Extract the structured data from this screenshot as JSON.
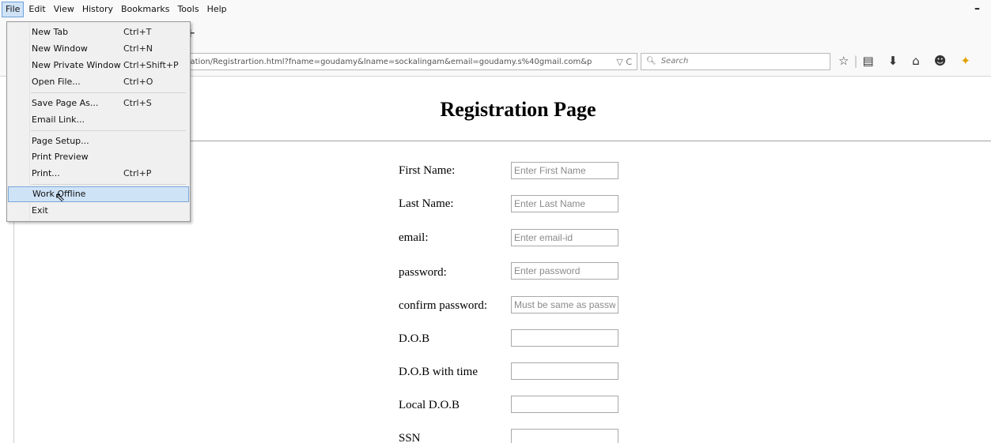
{
  "menubar": {
    "items": [
      {
        "label": "File",
        "active": true
      },
      {
        "label": "Edit"
      },
      {
        "label": "View"
      },
      {
        "label": "History"
      },
      {
        "label": "Bookmarks"
      },
      {
        "label": "Tools"
      },
      {
        "label": "Help"
      }
    ],
    "minimize": "–"
  },
  "tabs": {
    "newtab": "+"
  },
  "navbar": {
    "url": "cation/Registrartion.html?fname=goudamy&lname=sockalingam&email=goudamy.s%40gmail.com&p",
    "url_icons": "▽ C",
    "search_placeholder": "Search",
    "icons": [
      "star-icon",
      "reading-list-icon",
      "download-icon",
      "home-icon",
      "chat-icon",
      "extension-icon"
    ]
  },
  "page": {
    "title": "Registration Page",
    "fields": [
      {
        "label": "First Name:",
        "placeholder": "Enter First Name",
        "value": ""
      },
      {
        "label": "Last Name:",
        "placeholder": "Enter Last Name",
        "value": ""
      },
      {
        "label": "email:",
        "placeholder": "Enter email-id",
        "value": ""
      },
      {
        "label": "password:",
        "placeholder": "Enter password",
        "value": ""
      },
      {
        "label": "confirm password:",
        "placeholder": "Must be same as password",
        "value": ""
      },
      {
        "label": "D.O.B",
        "placeholder": "",
        "value": ""
      },
      {
        "label": "D.O.B with time",
        "placeholder": "",
        "value": ""
      },
      {
        "label": "Local D.O.B",
        "placeholder": "",
        "value": ""
      },
      {
        "label": "SSN",
        "placeholder": "",
        "value": ""
      }
    ]
  },
  "file_menu": {
    "items": [
      {
        "label": "New Tab",
        "shortcut": "Ctrl+T"
      },
      {
        "label": "New Window",
        "shortcut": "Ctrl+N"
      },
      {
        "label": "New Private Window",
        "shortcut": "Ctrl+Shift+P"
      },
      {
        "label": "Open File...",
        "shortcut": "Ctrl+O"
      },
      {
        "label": "Save Page As...",
        "shortcut": "Ctrl+S"
      },
      {
        "label": "Email Link...",
        "shortcut": ""
      },
      {
        "label": "Page Setup...",
        "shortcut": ""
      },
      {
        "label": "Print Preview",
        "shortcut": ""
      },
      {
        "label": "Print...",
        "shortcut": "Ctrl+P"
      },
      {
        "label": "Work Offline",
        "shortcut": "",
        "highlighted": true
      },
      {
        "label": "Exit",
        "shortcut": ""
      }
    ]
  }
}
